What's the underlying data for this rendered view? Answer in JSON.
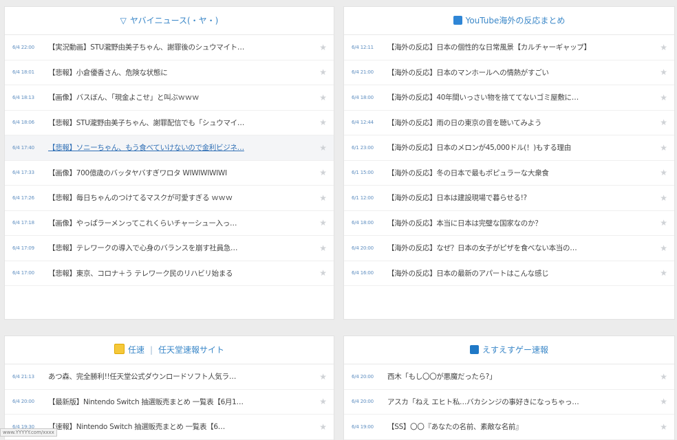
{
  "panels": [
    {
      "title": "ヤバイニュース(・ヤ・)",
      "icon": "yabai-icon",
      "items": [
        {
          "time": "6/4 22:00",
          "title": "【実況動画】STU瀧野由美子ちゃん、謝罪後のシュウマイト…"
        },
        {
          "time": "6/4 18:01",
          "title": "【悲報】小倉優香さん、危険な状態に"
        },
        {
          "time": "6/4 18:13",
          "title": "【画像】バスぼん、「現金よこせ」と叫ぶｗｗｗ"
        },
        {
          "time": "6/4 18:06",
          "title": "【悲報】STU瀧野由美子ちゃん、謝罪配信でも「シュウマイ…"
        },
        {
          "time": "6/4 17:40",
          "title": "【悲報】ソニーちゃん、もう食べていけないので金利ビジネ…"
        },
        {
          "time": "6/4 17:33",
          "title": "【画像】700億歳のバッタヤバすぎワロタ WIWIWIWIWI"
        },
        {
          "time": "6/4 17:26",
          "title": "【悲報】毎日ちゃんのつけてるマスクが可愛すぎる ｗｗｗ"
        },
        {
          "time": "6/4 17:18",
          "title": "【画像】やっぱラーメンってこれくらいチャーシュー入っ…"
        },
        {
          "time": "6/4 17:09",
          "title": "【悲報】テレワークの導入で心身のバランスを崩す社員急…"
        },
        {
          "time": "6/4 17:00",
          "title": "【悲報】東京、コロナ＋う テレワーク民のリハビリ始まる"
        }
      ]
    },
    {
      "title": "YouTube海外の反応まとめ",
      "icon": "youtube-icon",
      "items": [
        {
          "time": "6/4 12:11",
          "title": "【海外の反応】日本の個性的な日常風景【カルチャーギャップ】"
        },
        {
          "time": "6/4 21:00",
          "title": "【海外の反応】日本のマンホールへの情熱がすごい"
        },
        {
          "time": "6/4 18:00",
          "title": "【海外の反応】40年間いっさい物を捨ててないゴミ屋敷に…"
        },
        {
          "time": "6/4 12:44",
          "title": "【海外の反応】雨の日の東京の音を聴いてみよう"
        },
        {
          "time": "6/1 23:00",
          "title": "【海外の反応】日本のメロンが45,000ドル(！)もする理由"
        },
        {
          "time": "6/1 15:00",
          "title": "【海外の反応】冬の日本で最もポピュラーな大衆食"
        },
        {
          "time": "6/1 12:00",
          "title": "【海外の反応】日本は建設現場で暮らせる!?"
        },
        {
          "time": "6/4 18:00",
          "title": "【海外の反応】本当に日本は完璧な国家なのか？"
        },
        {
          "time": "6/4 20:00",
          "title": "【海外の反応】なぜ？日本の女子がピザを食べない本当の…"
        },
        {
          "time": "6/4 16:00",
          "title": "【海外の反応】日本の最新のアパートはこんな感じ"
        }
      ]
    },
    {
      "title": "任速",
      "title_sub": "任天堂速報サイト",
      "icon": "nintendo-icon",
      "items": [
        {
          "time": "6/4 21:13",
          "title": "あつ森、完全勝利!!任天堂公式ダウンロードソフト人気ラ…"
        },
        {
          "time": "6/4 20:00",
          "title": "【最新版】Nintendo Switch 抽選販売まとめ 一覧表【6月1…"
        },
        {
          "time": "6/4 19:30",
          "title": "【速報】Nintendo Switch 抽選販売まとめ 一覧表【6…"
        }
      ]
    },
    {
      "title": "えすえすゲー速報",
      "icon": "esu-icon",
      "items": [
        {
          "time": "6/4 20:00",
          "title": "西木「もし〇〇が悪魔だったら?」"
        },
        {
          "time": "6/4 20:00",
          "title": "アスカ「ねえ エヒト私…バカシンジの事好きになっちゃっ…"
        },
        {
          "time": "6/4 19:00",
          "title": "【SS】〇〇『あなたの名前、素敵な名前』"
        }
      ]
    }
  ],
  "status_url": "www.YYYYY.com/xxxx"
}
